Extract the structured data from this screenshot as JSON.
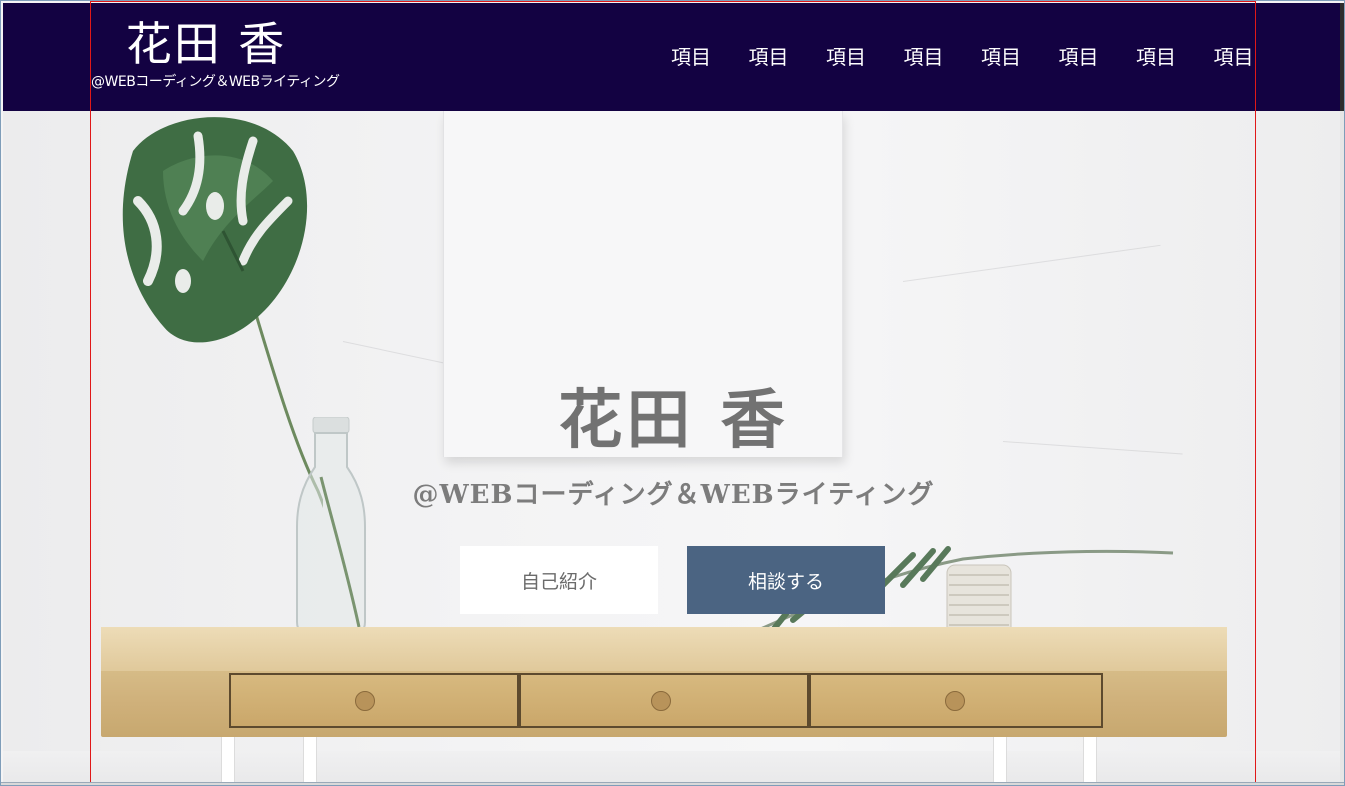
{
  "header": {
    "logo_name": "花田 香",
    "logo_tagline": "@WEBコーディング＆WEBライティング",
    "background": "#130242"
  },
  "nav": {
    "items": [
      "項目",
      "項目",
      "項目",
      "項目",
      "項目",
      "項目",
      "項目",
      "項目"
    ]
  },
  "hero": {
    "title": "花田 香",
    "subtitle": "@WEBコーディング＆WEBライティング",
    "buttons": {
      "about_label": "自己紹介",
      "consult_label": "相談する"
    },
    "colors": {
      "consult_button": "#4b6482",
      "about_button": "#ffffff",
      "text": "#727272"
    }
  },
  "guide_frame_color": "#e01818"
}
